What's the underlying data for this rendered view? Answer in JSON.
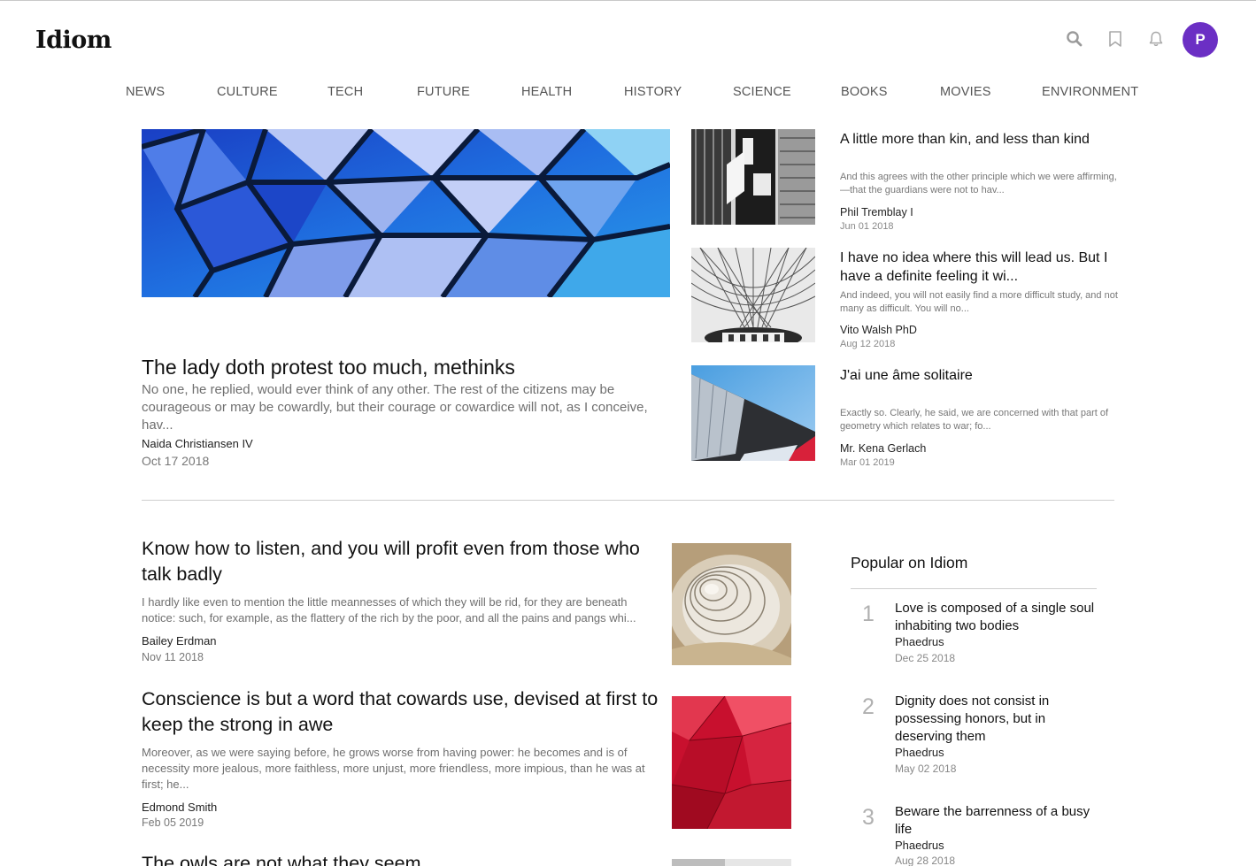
{
  "header": {
    "logo": "Idiom",
    "icons": [
      "search-icon",
      "bookmark-icon",
      "bell-icon"
    ],
    "avatar_initial": "P",
    "avatar_color": "#6b2fc4"
  },
  "nav": {
    "items": [
      "NEWS",
      "CULTURE",
      "TECH",
      "FUTURE",
      "HEALTH",
      "HISTORY",
      "SCIENCE",
      "BOOKS",
      "MOVIES",
      "ENVIRONMENT"
    ]
  },
  "hero": {
    "title": "The lady doth protest too much, methinks",
    "excerpt": "No one, he replied, would ever think of any other. The rest of the citizens may be courageous or may be cowardly, but their courage or cowardice will not, as I conceive, hav...",
    "author": "Naida Christiansen IV",
    "date": "Oct 17 2018"
  },
  "side_articles": [
    {
      "title": "A little more than kin, and less than kind",
      "excerpt": "And this agrees with the other principle which we were affirming,—that the guardians were not to hav...",
      "author": "Phil Tremblay I",
      "date": "Jun 01 2018"
    },
    {
      "title": "I have no idea where this will lead us. But I have a definite feeling it wi...",
      "excerpt": "And indeed, you will not easily find a more difficult study, and not many as difficult. You will no...",
      "author": "Vito Walsh PhD",
      "date": "Aug 12 2018"
    },
    {
      "title": "J'ai une âme solitaire",
      "excerpt": "Exactly so. Clearly, he said, we are concerned with that part of geometry which relates to war; fo...",
      "author": "Mr. Kena Gerlach",
      "date": "Mar 01 2019"
    }
  ],
  "articles": [
    {
      "title": "Know how to listen, and you will profit even from those who talk badly",
      "excerpt": "I hardly like even to mention the little meannesses of which they will be rid, for they are beneath notice: such, for example, as the flattery of the rich by the poor, and all the pains and pangs whi...",
      "author": "Bailey Erdman",
      "date": "Nov 11 2018"
    },
    {
      "title": "Conscience is but a word that cowards use, devised at first to keep the strong in awe",
      "excerpt": "Moreover, as we were saying before, he grows worse from having power: he becomes and is of necessity more jealous, more faithless, more unjust, more friendless, more impious, than he was at first; he...",
      "author": "Edmond Smith",
      "date": "Feb 05 2019"
    },
    {
      "title": "The owls are not what they seem"
    }
  ],
  "popular": {
    "heading": "Popular on Idiom",
    "items": [
      {
        "rank": "1",
        "title": "Love is composed of a single soul inhabiting two bodies",
        "author": "Phaedrus",
        "date": "Dec 25 2018"
      },
      {
        "rank": "2",
        "title": "Dignity does not consist in possessing honors, but in deserving them",
        "author": "Phaedrus",
        "date": "May 02 2018"
      },
      {
        "rank": "3",
        "title": "Beware the barrenness of a busy life",
        "author": "Phaedrus",
        "date": "Aug 28 2018"
      }
    ]
  }
}
